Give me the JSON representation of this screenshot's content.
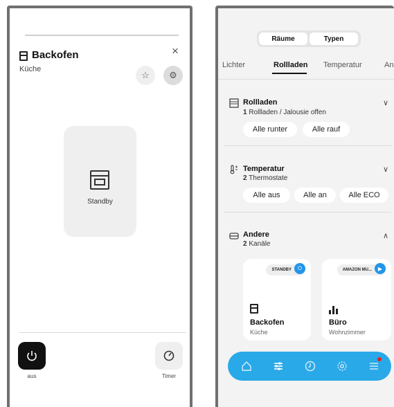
{
  "left": {
    "device_title": "Backofen",
    "room": "Küche",
    "close_glyph": "×",
    "star_glyph": "☆",
    "settings_glyph": "⚙",
    "status": "Standby",
    "power_label": "aus",
    "timer_label": "Timer",
    "icons": [
      "oven-icon",
      "close-icon",
      "star-icon",
      "gear-icon",
      "power-icon",
      "timer-icon"
    ]
  },
  "right": {
    "segments": [
      "Räume",
      "Typen"
    ],
    "tabs": [
      "Lichter",
      "Rollladen",
      "Temperatur",
      "An"
    ],
    "active_tab": "Rollladen",
    "sections": [
      {
        "title": "Rollladen",
        "count": "1",
        "sub": "Rollladen / Jalousie offen",
        "buttons": [
          "Alle runter",
          "Alle rauf"
        ],
        "chevron": "∨"
      },
      {
        "title": "Temperatur",
        "count": "2",
        "sub": "Thermostate",
        "buttons": [
          "Alle aus",
          "Alle an",
          "Alle ECO"
        ],
        "chevron": "∨"
      },
      {
        "title": "Andere",
        "count": "2",
        "sub": "Kanäle",
        "chevron": "∧"
      }
    ],
    "tiles": [
      {
        "badge": "STANDBY",
        "name": "Backofen",
        "room": "Küche",
        "icon": "oven-icon"
      },
      {
        "badge": "AMAZON MU...",
        "name": "Büro",
        "room": "Wohnzimmer",
        "icon": "equalizer-icon"
      }
    ],
    "nav_icons": [
      "home-icon",
      "sliders-icon",
      "clock-icon",
      "gear-icon",
      "menu-icon"
    ],
    "colors": {
      "accent": "#29a9e8",
      "notification": "#e52525"
    }
  }
}
